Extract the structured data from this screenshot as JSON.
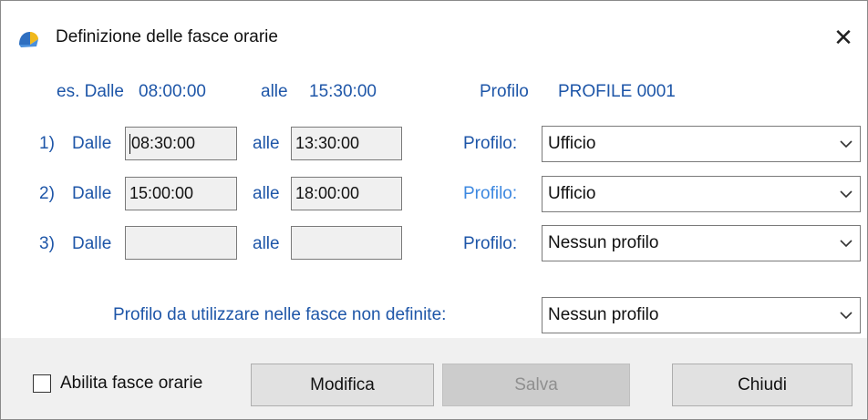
{
  "window": {
    "title": "Definizione delle fasce orarie",
    "close_label": "✕"
  },
  "example": {
    "prefix": "es. Dalle",
    "from": "08:00:00",
    "to_label": "alle",
    "to": "15:30:00",
    "profile_label": "Profilo",
    "profile": "PROFILE 0001"
  },
  "ranges": [
    {
      "index": "1)",
      "from_label": "Dalle",
      "from": "08:30:00",
      "to_label": "alle",
      "to": "13:30:00",
      "profile_label": "Profilo:",
      "profile": "Ufficio"
    },
    {
      "index": "2)",
      "from_label": "Dalle",
      "from": "15:00:00",
      "to_label": "alle",
      "to": "18:00:00",
      "profile_label": "Profilo:",
      "profile": "Ufficio"
    },
    {
      "index": "3)",
      "from_label": "Dalle",
      "from": "",
      "to_label": "alle",
      "to": "",
      "profile_label": "Profilo:",
      "profile": "Nessun profilo"
    }
  ],
  "undefined_profile": {
    "label": "Profilo da utilizzare nelle fasce non definite:",
    "value": "Nessun profilo"
  },
  "footer": {
    "enable_label": "Abilita fasce orarie",
    "enable_checked": false,
    "modify_label": "Modifica",
    "save_label": "Salva",
    "close_label": "Chiudi"
  },
  "colors": {
    "label_blue": "#1e56a8",
    "highlight_blue": "#3d88e0",
    "field_bg": "#f0f0f0",
    "disabled_button": "#cccccc"
  }
}
